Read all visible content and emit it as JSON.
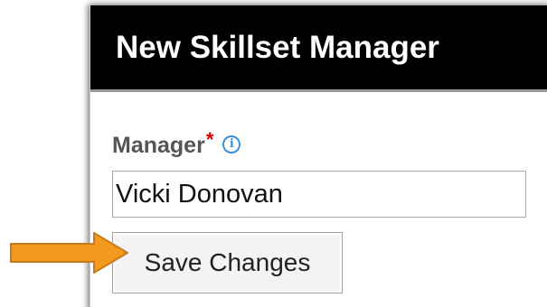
{
  "dialog": {
    "title": "New Skillset Manager"
  },
  "form": {
    "manager_label": "Manager",
    "required_marker": "*",
    "info_icon_glyph": "i",
    "manager_value": "Vicki Donovan"
  },
  "actions": {
    "save_label": "Save Changes"
  },
  "icons": {
    "info": "info-icon",
    "pointer_arrow": "arrow-right-icon"
  },
  "colors": {
    "header_background": "#000000",
    "header_text": "#ffffff",
    "required_marker": "#d60000",
    "info_icon": "#3a8fd9",
    "arrow_fill": "#f39a1e",
    "arrow_stroke": "#c9781a"
  }
}
